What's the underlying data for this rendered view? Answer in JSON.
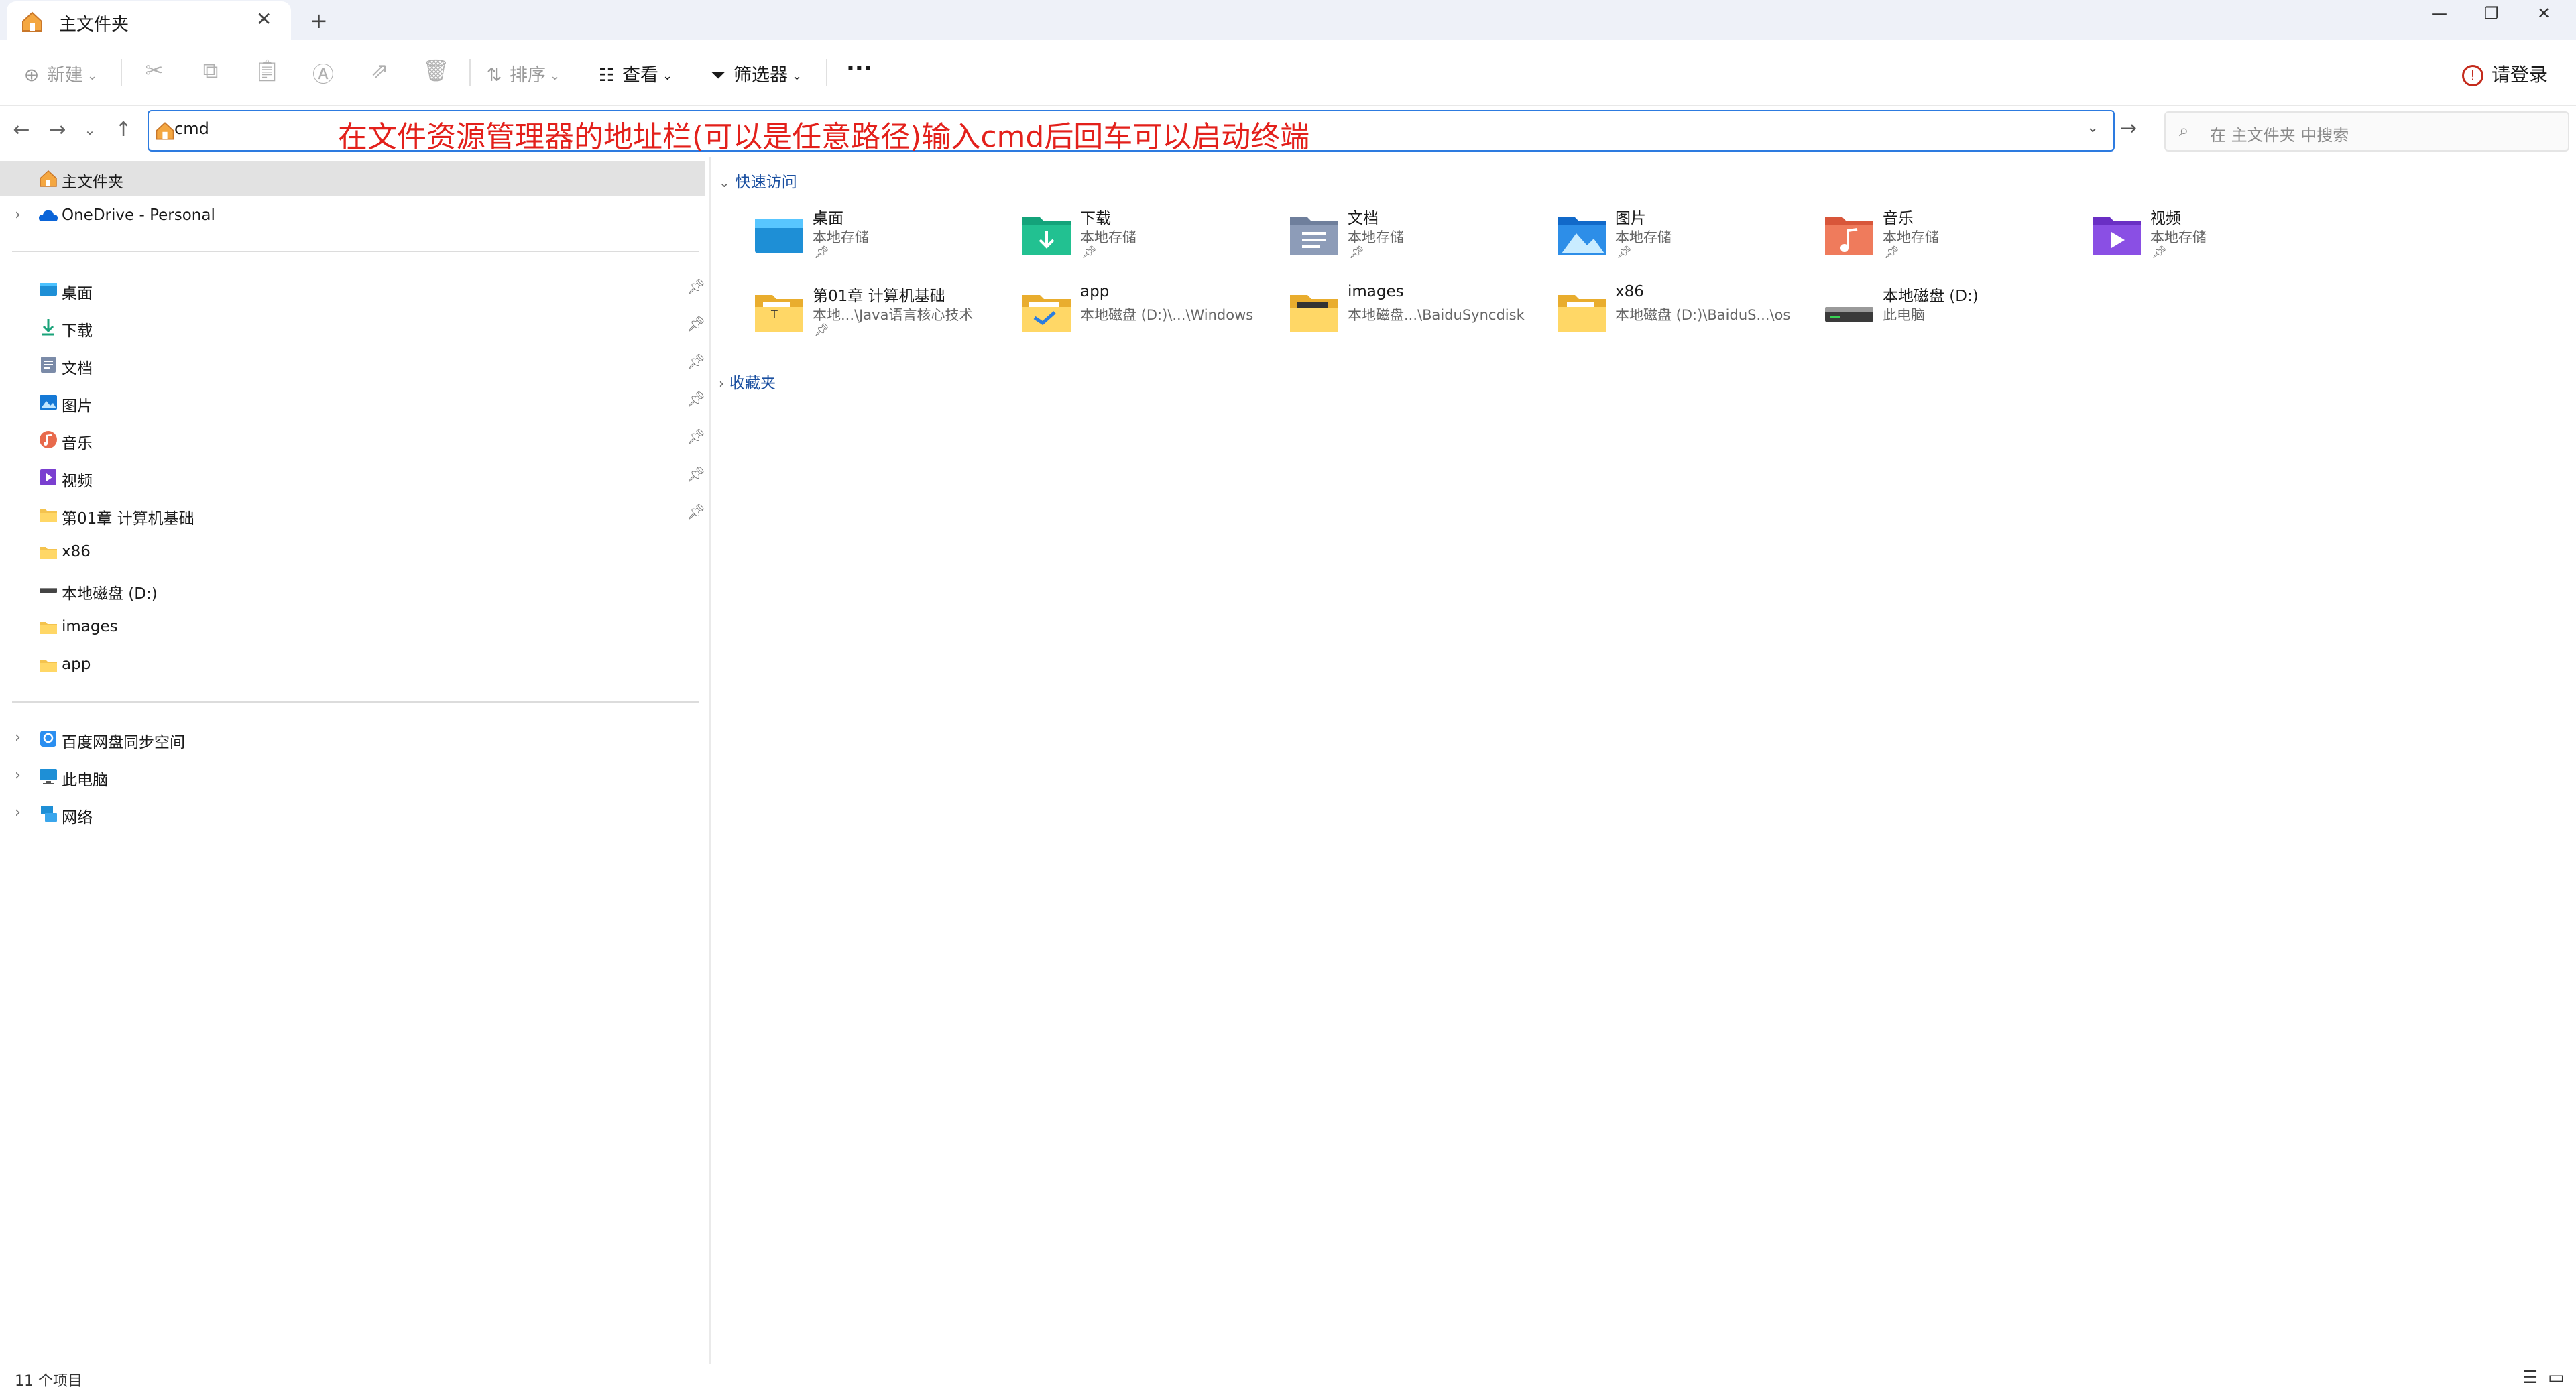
{
  "window": {
    "tab_title": "主文件夹",
    "tab_close": "✕",
    "new_tab": "+",
    "minimize": "—",
    "restore": "❐",
    "close": "✕"
  },
  "toolbar": {
    "new_label": "新建",
    "sort_label": "排序",
    "view_label": "查看",
    "filter_label": "筛选器",
    "more_label": "···",
    "login_label": "请登录",
    "icons": [
      "cut-icon",
      "copy-icon",
      "paste-icon",
      "rename-icon",
      "share-icon",
      "delete-icon"
    ]
  },
  "address": {
    "value": "cmd",
    "annotation": "在文件资源管理器的地址栏(可以是任意路径)输入cmd后回车可以启动终端",
    "search_placeholder": "在 主文件夹 中搜索"
  },
  "sidebar": {
    "top": [
      {
        "label": "主文件夹",
        "icon": "home-icon",
        "selected": true
      },
      {
        "label": "OneDrive - Personal",
        "icon": "cloud-icon",
        "expandable": true
      }
    ],
    "pinned": [
      {
        "label": "桌面",
        "icon": "desktop-icon",
        "pinned": true
      },
      {
        "label": "下载",
        "icon": "download-icon",
        "pinned": true
      },
      {
        "label": "文档",
        "icon": "document-icon",
        "pinned": true
      },
      {
        "label": "图片",
        "icon": "picture-icon",
        "pinned": true
      },
      {
        "label": "音乐",
        "icon": "music-icon",
        "pinned": true
      },
      {
        "label": "视频",
        "icon": "video-icon",
        "pinned": true
      },
      {
        "label": "第01章 计算机基础",
        "icon": "folder-icon",
        "pinned": true
      },
      {
        "label": "x86",
        "icon": "folder-icon"
      },
      {
        "label": "本地磁盘 (D:)",
        "icon": "drive-icon"
      },
      {
        "label": "images",
        "icon": "folder-icon"
      },
      {
        "label": "app",
        "icon": "folder-icon"
      }
    ],
    "bottom": [
      {
        "label": "百度网盘同步空间",
        "icon": "baidu-sync-icon",
        "expandable": true
      },
      {
        "label": "此电脑",
        "icon": "computer-icon",
        "expandable": true
      },
      {
        "label": "网络",
        "icon": "network-icon",
        "expandable": true
      }
    ]
  },
  "main": {
    "quick_access_label": "快速访问",
    "favorites_label": "收藏夹",
    "items": [
      {
        "name": "桌面",
        "sub": "本地存储",
        "icon": "desktop-folder-icon",
        "pinned": true
      },
      {
        "name": "下载",
        "sub": "本地存储",
        "icon": "downloads-folder-icon",
        "pinned": true
      },
      {
        "name": "文档",
        "sub": "本地存储",
        "icon": "documents-folder-icon",
        "pinned": true
      },
      {
        "name": "图片",
        "sub": "本地存储",
        "icon": "pictures-folder-icon",
        "pinned": true
      },
      {
        "name": "音乐",
        "sub": "本地存储",
        "icon": "music-folder-icon",
        "pinned": true
      },
      {
        "name": "视频",
        "sub": "本地存储",
        "icon": "videos-folder-icon",
        "pinned": true
      },
      {
        "name": "第01章 计算机基础",
        "sub": "本地...\\Java语言核心技术",
        "icon": "folder-icon",
        "pinned": true
      },
      {
        "name": "app",
        "sub": "本地磁盘 (D:)\\...\\Windows",
        "icon": "folder-icon"
      },
      {
        "name": "images",
        "sub": "本地磁盘...\\BaiduSyncdisk",
        "icon": "folder-icon"
      },
      {
        "name": "x86",
        "sub": "本地磁盘 (D:)\\BaiduS...\\os",
        "icon": "folder-icon"
      },
      {
        "name": "本地磁盘 (D:)",
        "sub": "此电脑",
        "icon": "drive-icon"
      }
    ]
  },
  "status": {
    "count": "11 个项目"
  },
  "colors": {
    "accent": "#2d7be0",
    "annotation": "#e3201b",
    "folder": "#f4c34e",
    "selected_bg": "#e2e2e2"
  }
}
